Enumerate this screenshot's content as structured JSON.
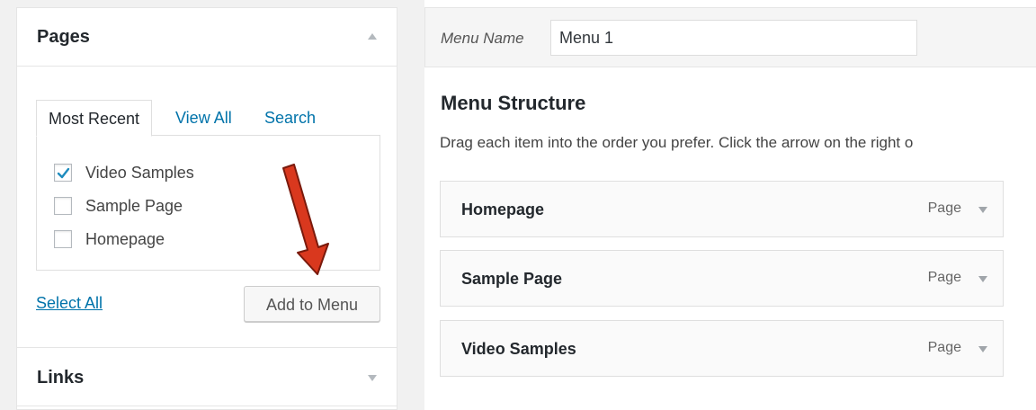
{
  "sidebar": {
    "pages_section": {
      "title": "Pages",
      "tabs": [
        "Most Recent",
        "View All",
        "Search"
      ],
      "items": [
        {
          "label": "Video Samples",
          "checked": true
        },
        {
          "label": "Sample Page",
          "checked": false
        },
        {
          "label": "Homepage",
          "checked": false
        }
      ],
      "select_all": "Select All",
      "add_button": "Add to Menu"
    },
    "links_section": {
      "title": "Links"
    }
  },
  "menu": {
    "name_label": "Menu Name",
    "name_value": "Menu 1",
    "structure_title": "Menu Structure",
    "structure_desc": "Drag each item into the order you prefer. Click the arrow on the right o",
    "items": [
      {
        "title": "Homepage",
        "type": "Page"
      },
      {
        "title": "Sample Page",
        "type": "Page"
      },
      {
        "title": "Video Samples",
        "type": "Page"
      }
    ]
  },
  "colors": {
    "link": "#0073aa",
    "annotation_arrow": "#d9381e",
    "checkmark": "#1e8cbe"
  }
}
